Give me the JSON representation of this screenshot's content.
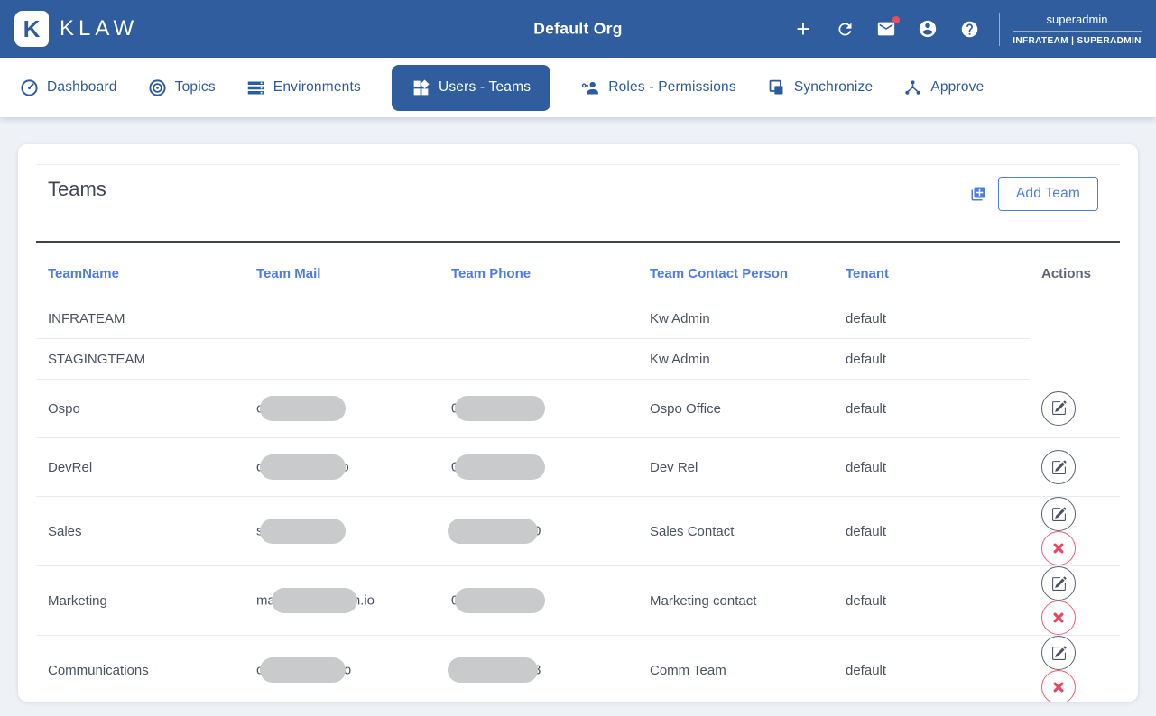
{
  "header": {
    "brand": "KLAW",
    "logo_glyph": "K",
    "title": "Default Org",
    "user_name": "superadmin",
    "user_role": "INFRATEAM | SUPERADMIN",
    "icons": [
      "plus-icon",
      "refresh-icon",
      "mail-icon-with-unread-badge",
      "account-icon",
      "help-icon"
    ]
  },
  "nav": {
    "items": [
      {
        "label": "Dashboard",
        "icon": "gauge-icon",
        "active": false
      },
      {
        "label": "Topics",
        "icon": "target-icon",
        "active": false
      },
      {
        "label": "Environments",
        "icon": "server-stack-icon",
        "active": false
      },
      {
        "label": "Users - Teams",
        "icon": "widgets-icon",
        "active": true
      },
      {
        "label": "Roles - Permissions",
        "icon": "person-key-icon",
        "active": false
      },
      {
        "label": "Synchronize",
        "icon": "copy-squares-icon",
        "active": false
      },
      {
        "label": "Approve",
        "icon": "hub-icon",
        "active": false
      }
    ]
  },
  "teams": {
    "title": "Teams",
    "add_icon": "add-to-queue-icon",
    "add_button_label": "Add Team",
    "columns": [
      "TeamName",
      "Team Mail",
      "Team Phone",
      "Team Contact Person",
      "Tenant",
      "Actions"
    ],
    "rows": [
      {
        "name": "INFRATEAM",
        "mail": {
          "prefix": "",
          "redacted": false,
          "suffix": ""
        },
        "phone": {
          "prefix": "",
          "redacted": false,
          "suffix": ""
        },
        "contact": "Kw Admin",
        "tenant": "default",
        "actions": {
          "edit": false,
          "delete": false
        }
      },
      {
        "name": "STAGINGTEAM",
        "mail": {
          "prefix": "",
          "redacted": false,
          "suffix": ""
        },
        "phone": {
          "prefix": "",
          "redacted": false,
          "suffix": ""
        },
        "contact": "Kw Admin",
        "tenant": "default",
        "actions": {
          "edit": false,
          "delete": false
        }
      },
      {
        "name": "Ospo",
        "mail": {
          "prefix": "o",
          "redacted": true,
          "suffix": ""
        },
        "phone": {
          "prefix": "0",
          "redacted": true,
          "suffix": ""
        },
        "contact": "Ospo Office",
        "tenant": "default",
        "actions": {
          "edit": true,
          "delete": false
        }
      },
      {
        "name": "DevRel",
        "mail": {
          "prefix": "d",
          "redacted": true,
          "suffix": "o"
        },
        "phone": {
          "prefix": "0",
          "redacted": true,
          "suffix": ""
        },
        "contact": "Dev Rel",
        "tenant": "default",
        "actions": {
          "edit": true,
          "delete": false
        }
      },
      {
        "name": "Sales",
        "mail": {
          "prefix": "s",
          "redacted": true,
          "suffix": ""
        },
        "phone": {
          "prefix": "",
          "redacted": true,
          "suffix": "0"
        },
        "contact": "Sales Contact",
        "tenant": "default",
        "actions": {
          "edit": true,
          "delete": true
        }
      },
      {
        "name": "Marketing",
        "mail": {
          "prefix": "ma",
          "redacted": true,
          "suffix": "n.io"
        },
        "phone": {
          "prefix": "0",
          "redacted": true,
          "suffix": ""
        },
        "contact": "Marketing contact",
        "tenant": "default",
        "actions": {
          "edit": true,
          "delete": true
        }
      },
      {
        "name": "Communications",
        "mail": {
          "prefix": "c",
          "redacted": true,
          "suffix": "io"
        },
        "phone": {
          "prefix": "",
          "redacted": true,
          "suffix": "3"
        },
        "contact": "Comm Team",
        "tenant": "default",
        "actions": {
          "edit": true,
          "delete": true
        }
      }
    ]
  },
  "colors": {
    "header_blue": "#2f5d9e",
    "link_blue": "#4d7ce8",
    "delete_red": "#e8455f",
    "redaction_gray": "#c9cacc",
    "page_background": "#eef1f6"
  }
}
